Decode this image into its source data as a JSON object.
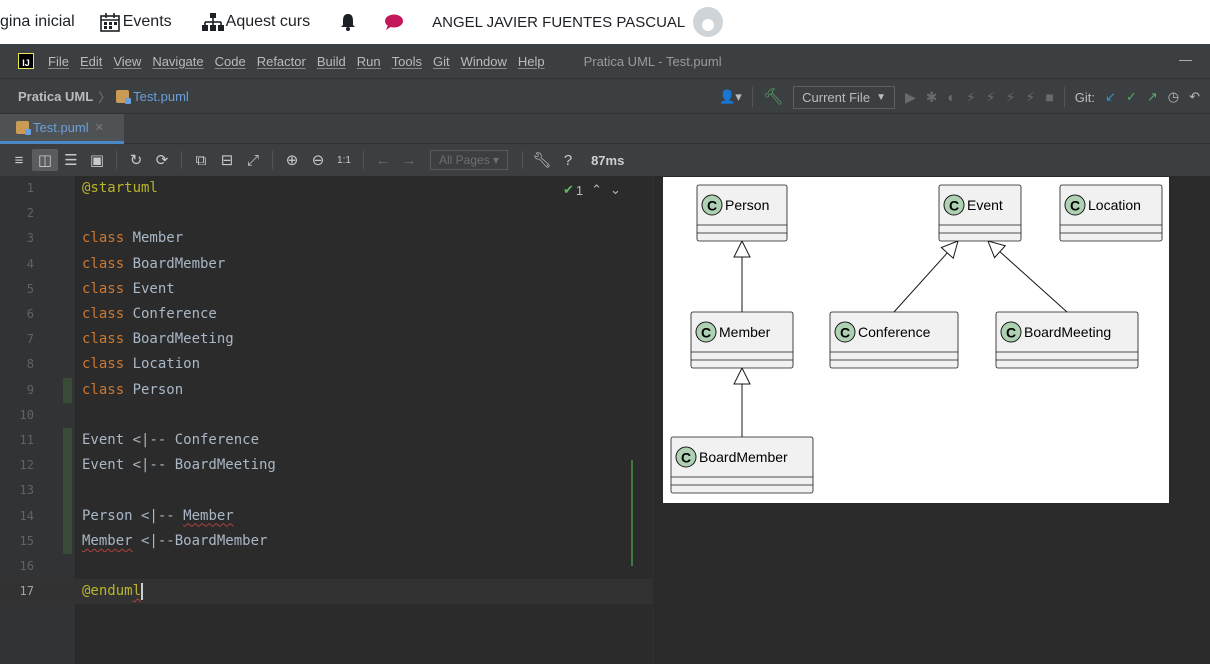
{
  "moodle": {
    "home": "gina inicial",
    "events": "Events",
    "course": "Aquest curs",
    "user": "ANGEL JAVIER FUENTES PASCUAL"
  },
  "ide": {
    "menus": [
      "File",
      "Edit",
      "View",
      "Navigate",
      "Code",
      "Refactor",
      "Build",
      "Run",
      "Tools",
      "Git",
      "Window",
      "Help"
    ],
    "window_title": "Pratica UML - Test.puml",
    "minimize": "—",
    "breadcrumb": {
      "project": "Pratica UML",
      "file": "Test.puml"
    },
    "run_config": "Current File",
    "git_label": "Git:",
    "tab": "Test.puml",
    "toolbar": {
      "all_pages": "All Pages",
      "help": "?",
      "render_time": "87ms",
      "zoom_reset": "1:1"
    },
    "inspection_count": "1"
  },
  "editor": {
    "current_line": 17,
    "lines": [
      {
        "n": "1",
        "tokens": [
          {
            "t": "@startuml",
            "c": "ann"
          }
        ]
      },
      {
        "n": "2",
        "tokens": []
      },
      {
        "n": "3",
        "tokens": [
          {
            "t": "class ",
            "c": "kw"
          },
          {
            "t": "Member",
            "c": "id"
          }
        ]
      },
      {
        "n": "4",
        "tokens": [
          {
            "t": "class ",
            "c": "kw"
          },
          {
            "t": "BoardMember",
            "c": "id"
          }
        ]
      },
      {
        "n": "5",
        "tokens": [
          {
            "t": "class ",
            "c": "kw"
          },
          {
            "t": "Event",
            "c": "id"
          }
        ]
      },
      {
        "n": "6",
        "tokens": [
          {
            "t": "class ",
            "c": "kw"
          },
          {
            "t": "Conference",
            "c": "id"
          }
        ]
      },
      {
        "n": "7",
        "tokens": [
          {
            "t": "class ",
            "c": "kw"
          },
          {
            "t": "BoardMeeting",
            "c": "id"
          }
        ]
      },
      {
        "n": "8",
        "tokens": [
          {
            "t": "class ",
            "c": "kw"
          },
          {
            "t": "Location",
            "c": "id"
          }
        ]
      },
      {
        "n": "9",
        "tokens": [
          {
            "t": "class ",
            "c": "kw"
          },
          {
            "t": "Person",
            "c": "id"
          }
        ]
      },
      {
        "n": "10",
        "tokens": []
      },
      {
        "n": "11",
        "tokens": [
          {
            "t": "Event <|-- Conference",
            "c": "id"
          }
        ]
      },
      {
        "n": "12",
        "tokens": [
          {
            "t": "Event <|-- BoardMeeting",
            "c": "id"
          }
        ]
      },
      {
        "n": "13",
        "tokens": []
      },
      {
        "n": "14",
        "tokens": [
          {
            "t": "Person <|-- ",
            "c": "id"
          },
          {
            "t": "Member",
            "c": "sq"
          }
        ]
      },
      {
        "n": "15",
        "tokens": [
          {
            "t": "Member",
            "c": "sq"
          },
          {
            "t": " <|--BoardMember",
            "c": "id"
          }
        ]
      },
      {
        "n": "16",
        "tokens": []
      },
      {
        "n": "17",
        "tokens": [
          {
            "t": "@endum",
            "c": "ann"
          },
          {
            "t": "l",
            "c": "annsq"
          }
        ]
      }
    ]
  },
  "diagram": {
    "stereotype": "C",
    "classes": [
      {
        "id": "person",
        "label": "Person"
      },
      {
        "id": "event",
        "label": "Event"
      },
      {
        "id": "location",
        "label": "Location"
      },
      {
        "id": "member",
        "label": "Member"
      },
      {
        "id": "conference",
        "label": "Conference"
      },
      {
        "id": "boardmeeting",
        "label": "BoardMeeting"
      },
      {
        "id": "boardmember",
        "label": "BoardMember"
      }
    ],
    "relations": [
      {
        "parent": "event",
        "child": "conference"
      },
      {
        "parent": "event",
        "child": "boardmeeting"
      },
      {
        "parent": "person",
        "child": "member"
      },
      {
        "parent": "member",
        "child": "boardmember"
      }
    ]
  },
  "colors": {
    "keyword": "#cc7832",
    "annotation": "#bbb529",
    "identifier": "#a9b7c6",
    "class_circle": "#add1b2",
    "accent": "#4a88c7"
  }
}
